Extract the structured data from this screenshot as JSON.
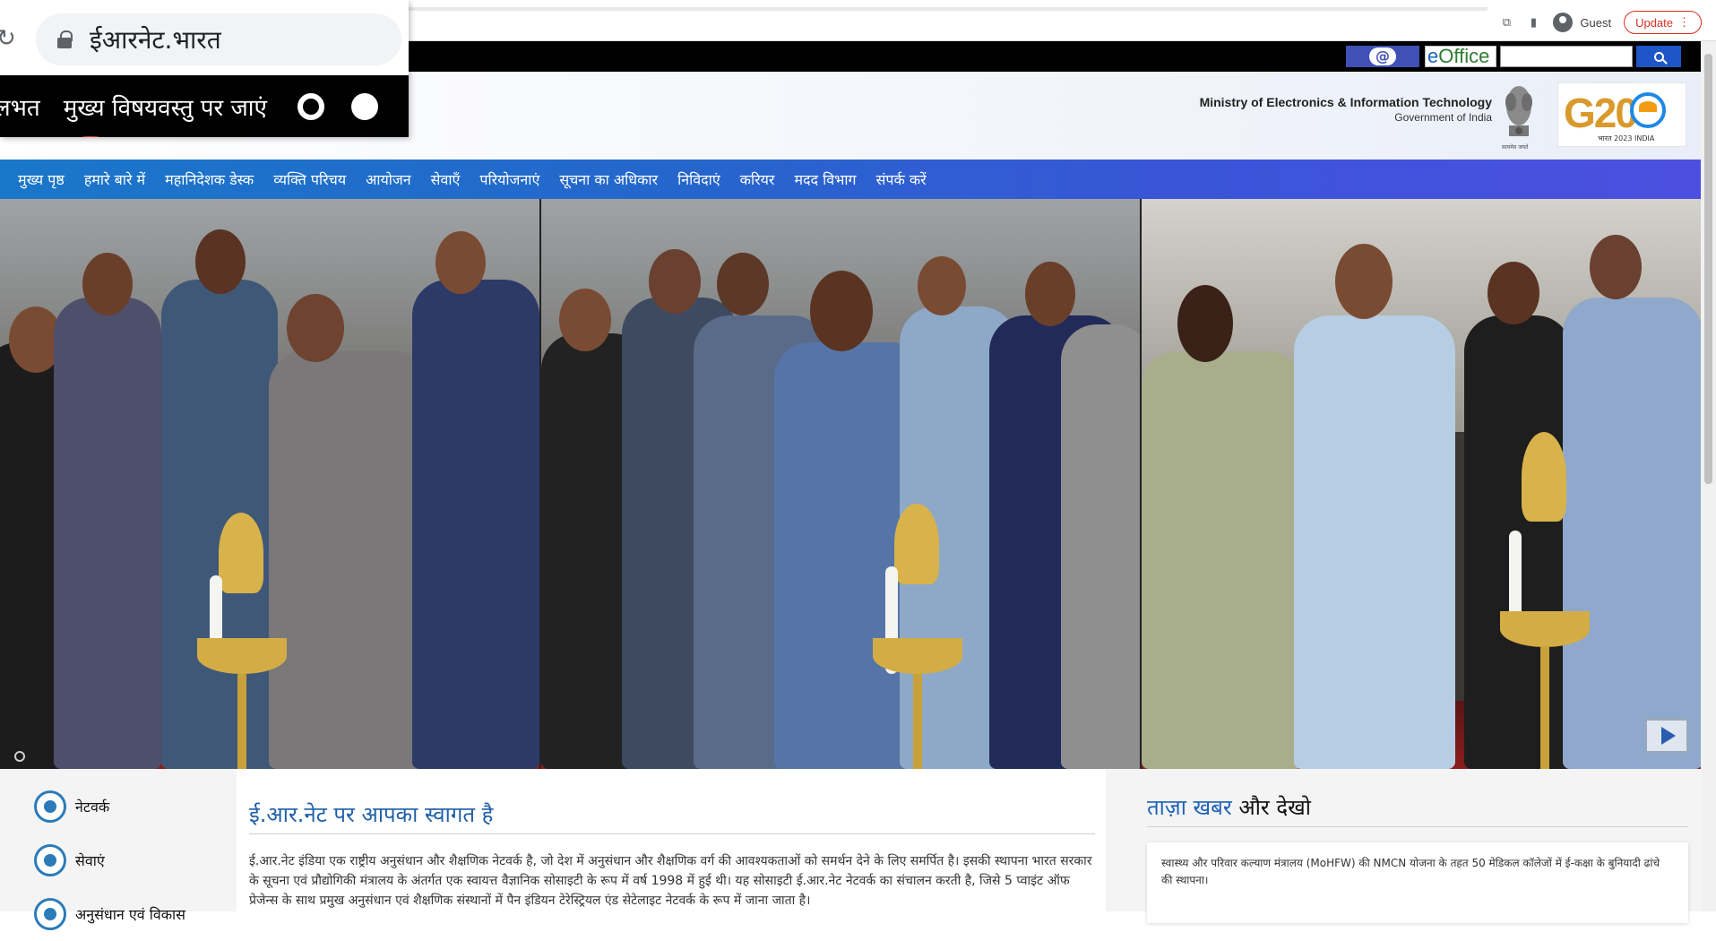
{
  "browser": {
    "profile_label": "Guest",
    "update_label": "Update"
  },
  "zoom_popup": {
    "url": "ईआरनेट.भारत",
    "skip_prefix": "लभत",
    "skip_link": "मुख्य विषयवस्तु पर जाएं"
  },
  "utility": {
    "mail_symbol": "@",
    "eoffice_e": "e",
    "eoffice_rest": "Office",
    "search_placeholder": ""
  },
  "header": {
    "ministry": "Ministry of Electronics & Information Technology",
    "government": "Government of India",
    "emblem_caption": "सत्यमेव जयते",
    "g20_text": "G20",
    "g20_sub": "भारत 2023 INDIA"
  },
  "nav": {
    "items": [
      "मुख्य पृष्ठ",
      "हमारे बारे में",
      "महानिदेशक डेस्क",
      "व्यक्ति परिचय",
      "आयोजन",
      "सेवाएँ",
      "परियोजनाएं",
      "सूचना का अधिकार",
      "निविदाएं",
      "करियर",
      "मदद विभाग",
      "संपर्क करें"
    ]
  },
  "quicklinks": [
    "नेटवर्क",
    "सेवाएं",
    "अनुसंधान एवं विकास"
  ],
  "welcome": {
    "title": "ई.आर.नेट पर आपका स्वागत है",
    "body": "ई.आर.नेट इंडिया एक राष्ट्रीय अनुसंधान और शैक्षणिक नेटवर्क है, जो देश में अनुसंधान और शैक्षणिक वर्ग की आवश्यकताओं को समर्थन देने के लिए समर्पित है। इसकी स्थापना भारत सरकार के सूचना एवं प्रौद्योगिकी मंत्रालय के अंतर्गत एक स्वायत्त वैज्ञानिक सोसाइटी के रूप में वर्ष 1998 में हुई थी। यह सोसाइटी ई.आर.नेट नेटवर्क का संचालन करती है, जिसे 5 प्वाइंट ऑफ प्रेजेन्स के साथ प्रमुख अनुसंधान एवं शैक्षणिक संस्थानों में पैन इंडियन टेरेस्ट्रियल एंड सेटेलाइट नेटवर्क के रूप में जाना जाता है।"
  },
  "news": {
    "title_highlight": "ताज़ा खबर",
    "title_rest": " और देखो",
    "item": "स्वास्थ्य और परिवार कल्याण मंत्रालय (MoHFW) की NMCN योजना के तहत 50 मेडिकल कॉलेजों में ई-कक्षा के बुनियादी ढांचे की स्थापना।"
  },
  "colors": {
    "nav_start": "#1a77c9",
    "nav_end": "#4d4fe0",
    "welcome_title": "#1f5fa8",
    "update_red": "#d93025"
  }
}
